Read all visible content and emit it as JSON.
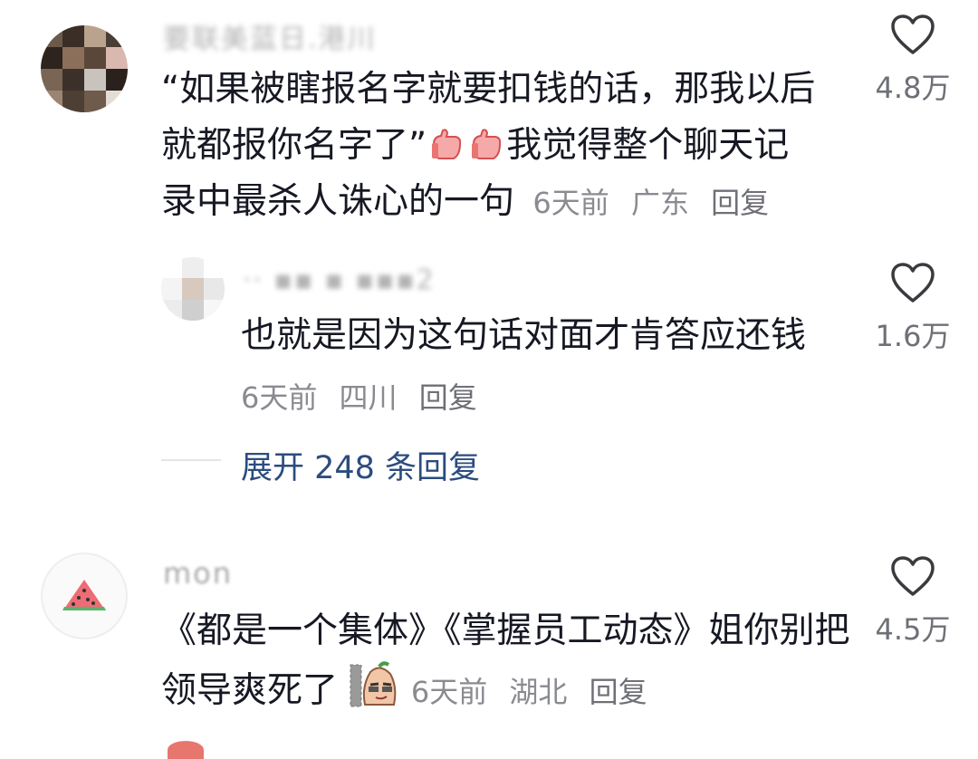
{
  "comments": [
    {
      "username": "要联美蓝日.港川",
      "text_line1": "“如果被瞎报名字就要扣钱的话，那我以后",
      "text_line2a": "就都报你名字了”",
      "text_line2b": "我觉得整个聊天记",
      "text_line3": "录中最杀人诛心的一句",
      "time": "6天前",
      "location": "广东",
      "reply": "回复",
      "likes": "4.8万"
    },
    {
      "username": "·· ▪▪ ▪ ▪▪▪2",
      "text": "也就是因为这句话对面才肯答应还钱",
      "time": "6天前",
      "location": "四川",
      "reply": "回复",
      "likes": "1.6万"
    },
    {
      "username": "mon",
      "text_line1": "《都是一个集体》《掌握员工动态》姐你别把",
      "text_line2": "领导爽死了",
      "time": "6天前",
      "location": "湖北",
      "reply": "回复",
      "likes": "4.5万"
    }
  ],
  "expand_replies": "展开 248 条回复",
  "icons": {
    "like": "heart-outline-icon",
    "thumbs": "thumbs-up-emoji",
    "sticker": "smirk-sticker",
    "avatar3": "watermelon-icon"
  },
  "colors": {
    "text": "#161823",
    "meta": "#8a8b91",
    "link": "#2b4c7e"
  }
}
